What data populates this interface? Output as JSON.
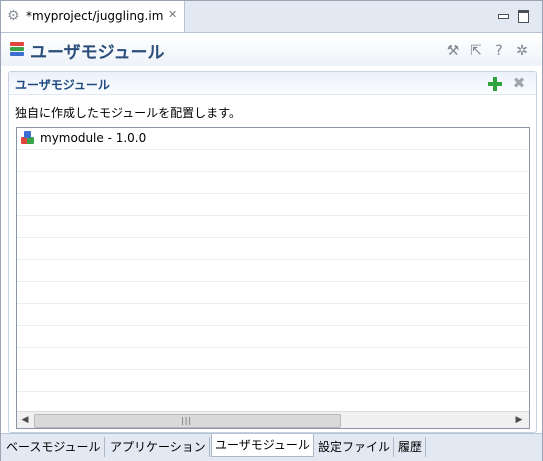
{
  "editor_tab": {
    "title": "*myproject/juggling.im",
    "icon": "gear-icon",
    "close_icon": "close-icon"
  },
  "window_controls": {
    "minimize_icon": "minimize-icon",
    "maximize_icon": "maximize-icon"
  },
  "header": {
    "title": "ユーザモジュール",
    "icon": "module-stack-icon",
    "toolbar_icons": [
      "wand-icon",
      "arrows-icon",
      "help-icon",
      "settings-gear-icon"
    ]
  },
  "section": {
    "title": "ユーザモジュール",
    "add_icon": "add-icon",
    "remove_icon": "remove-icon",
    "description": "独自に作成したモジュールを配置します。"
  },
  "modules": [
    {
      "label": "mymodule - 1.0.0",
      "icon": "module-icon"
    }
  ],
  "scrollbar": {
    "grip": "|||"
  },
  "bottom_tabs": [
    {
      "label": "ベースモジュール",
      "active": false
    },
    {
      "label": "アプリケーション",
      "active": false
    },
    {
      "label": "ユーザモジュール",
      "active": true
    },
    {
      "label": "設定ファイル",
      "active": false
    },
    {
      "label": "履歴",
      "active": false
    }
  ],
  "colors": {
    "accent": "#2a4d7a",
    "section_title": "#1f4a80",
    "add_green": "#2fa23a",
    "tab_bg": "#e2e9f3"
  }
}
